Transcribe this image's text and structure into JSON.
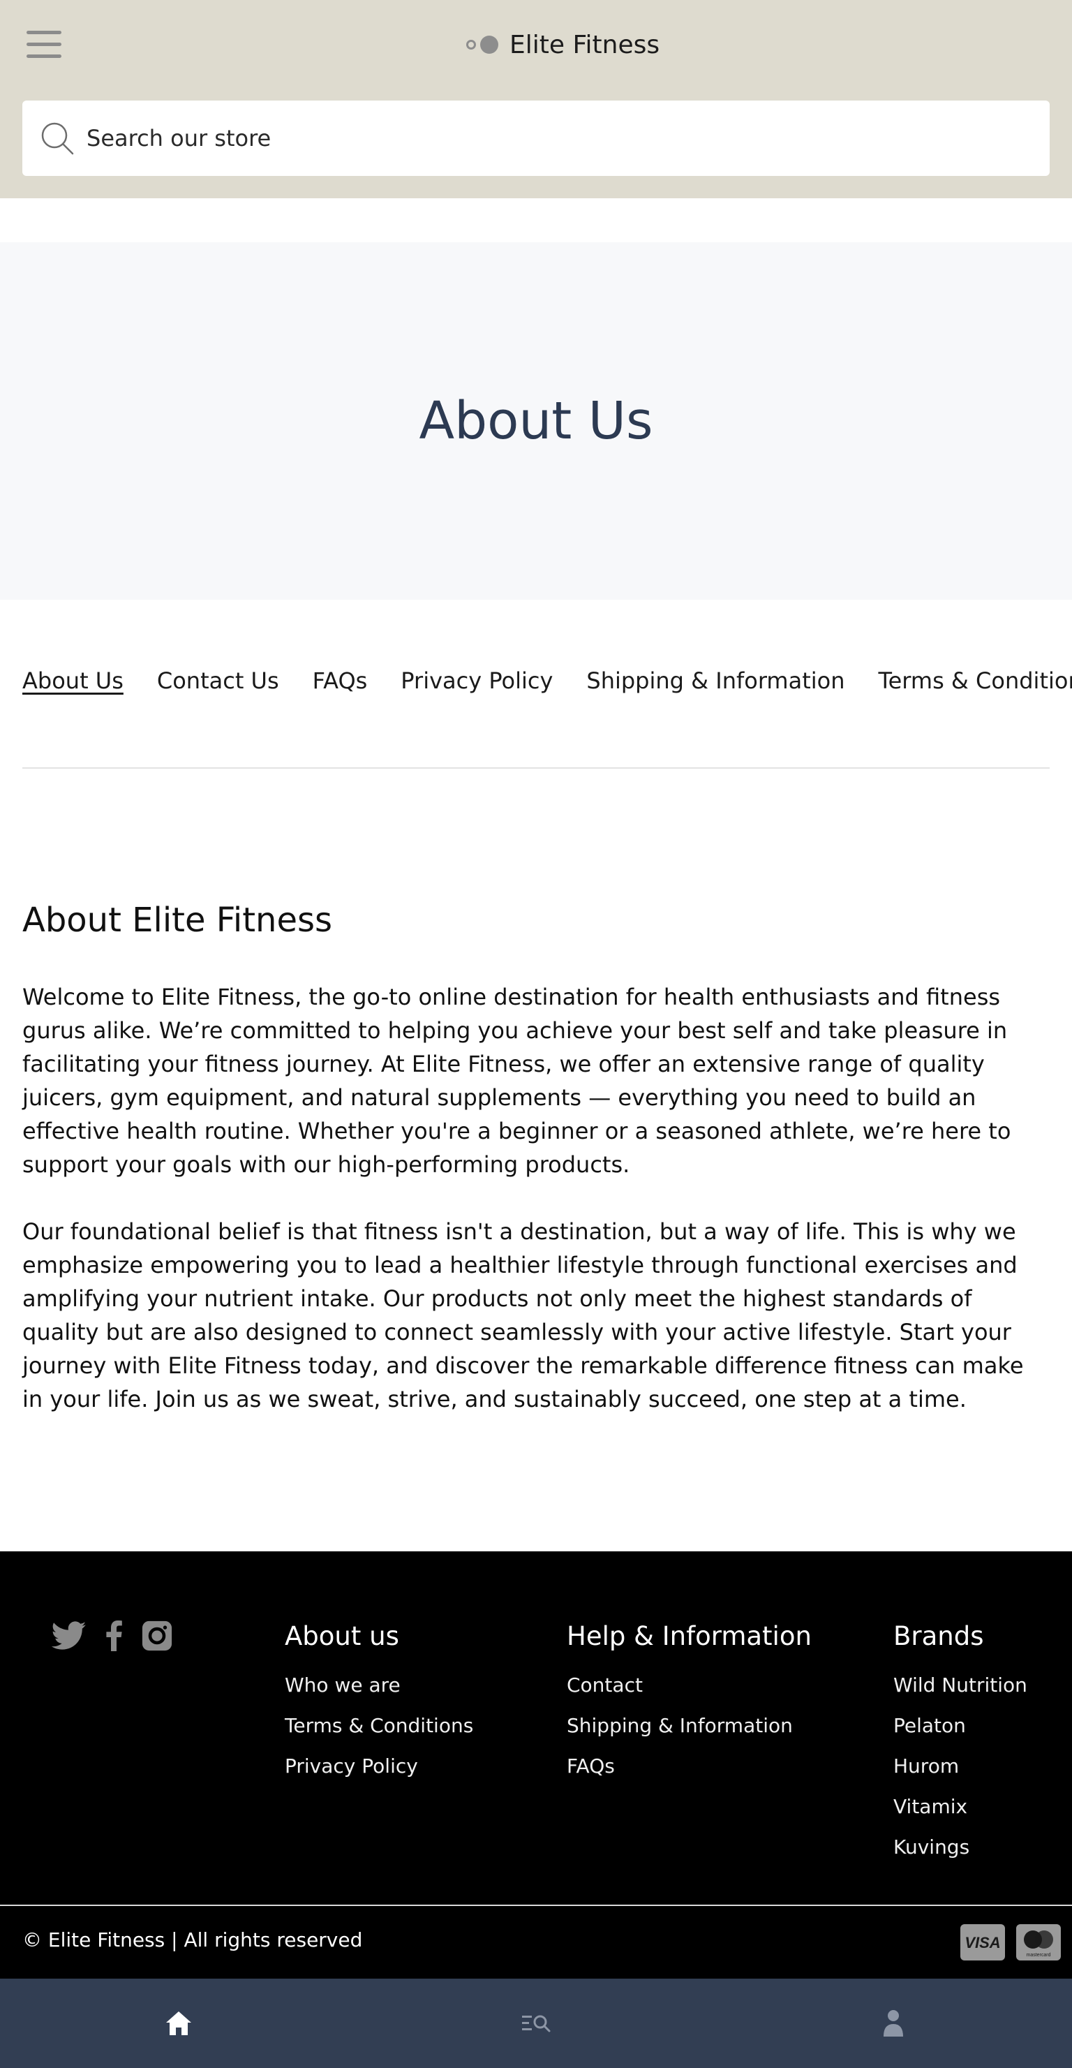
{
  "header": {
    "brand_name": "Elite Fitness",
    "search_placeholder": "Search our store"
  },
  "hero": {
    "title": "About Us"
  },
  "page_nav": [
    {
      "label": "About Us",
      "active": true
    },
    {
      "label": "Contact Us"
    },
    {
      "label": "FAQs"
    },
    {
      "label": "Privacy Policy"
    },
    {
      "label": "Shipping & Information"
    },
    {
      "label": "Terms & Conditions"
    }
  ],
  "content": {
    "title": "About Elite Fitness",
    "paragraph_1": "Welcome to Elite Fitness, the go-to online destination for health enthusiasts and fitness gurus alike. We’re committed to helping you achieve your best self and take pleasure in facilitating your fitness journey. At Elite Fitness, we offer an extensive range of quality juicers, gym equipment, and natural supplements — everything you need to build an effective health routine. Whether you're a beginner or a seasoned athlete, we’re here to support your goals with our high-performing products.",
    "paragraph_2": "Our foundational belief is that fitness isn't a destination, but a way of life. This is why we emphasize empowering you to lead a healthier lifestyle through functional exercises and amplifying your nutrient intake. Our products not only meet the highest standards of quality but are also designed to connect seamlessly with your active lifestyle. Start your journey with Elite Fitness today, and discover the remarkable difference fitness can make in your life. Join us as we sweat, strive, and sustainably succeed, one step at a time."
  },
  "footer": {
    "socials": [
      "twitter-icon",
      "facebook-icon",
      "instagram-icon"
    ],
    "columns": [
      {
        "title": "About us",
        "links": [
          "Who we are",
          "Terms & Conditions",
          "Privacy Policy"
        ]
      },
      {
        "title": "Help & Information",
        "links": [
          "Contact",
          "Shipping & Information",
          "FAQs"
        ]
      },
      {
        "title": "Brands",
        "links": [
          "Wild Nutrition",
          "Pelaton",
          "Hurom",
          "Vitamix",
          "Kuvings"
        ]
      }
    ],
    "copyright": "© Elite Fitness | All rights reserved",
    "payment": {
      "visa": "VISA",
      "mastercard": "mastercard"
    }
  },
  "bottom_bar": [
    "home-icon",
    "search-list-icon",
    "account-icon"
  ],
  "colors": {
    "header_bg": "#dedbcf",
    "hero_bg": "#f7f8fa",
    "hero_title": "#2c3a52",
    "footer_bg": "#000000",
    "bottom_bar_bg": "#323e53"
  }
}
